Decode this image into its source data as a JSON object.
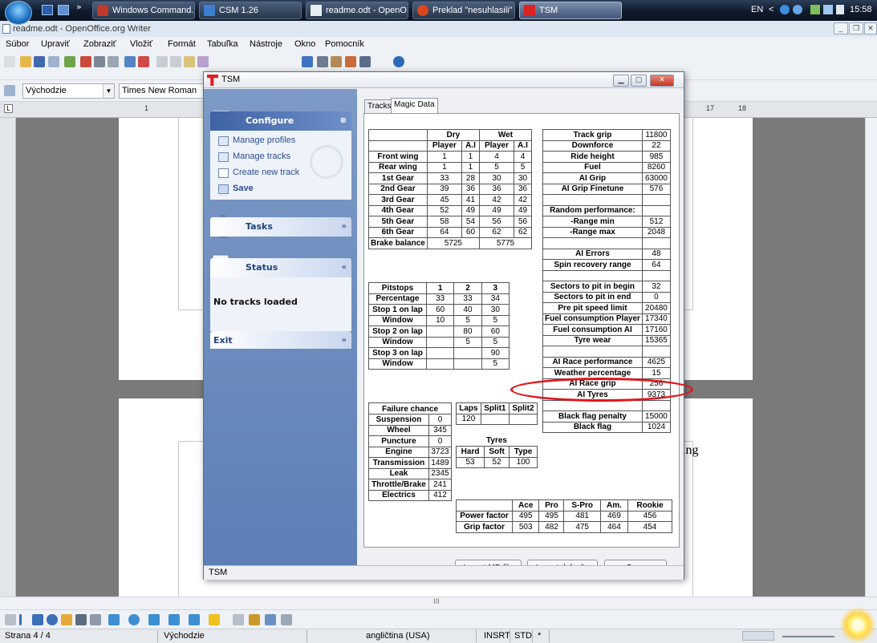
{
  "taskbar": {
    "buttons": [
      {
        "label": "Windows Command..."
      },
      {
        "label": "CSM 1.26"
      },
      {
        "label": "readme.odt - OpenO..."
      },
      {
        "label": "Preklad \"nesuhlasili\" ..."
      },
      {
        "label": "TSM"
      }
    ],
    "chevron": "»",
    "language": "EN",
    "clock": "15:58"
  },
  "writer": {
    "title": "readme.odt - OpenOffice.org Writer",
    "menu": [
      "Súbor",
      "Upraviť",
      "Zobraziť",
      "Vložiť",
      "Formát",
      "Tabuľka",
      "Nástroje",
      "Okno",
      "Pomocník"
    ],
    "style_combo": "Východzie",
    "font_combo": "Times New Roman",
    "ruler_marks": [
      "1",
      "17",
      "18"
    ],
    "page_fragment": "ing",
    "status": {
      "page": "Strana 4 / 4",
      "style": "Východzie",
      "language": "angličtina (USA)",
      "insert": "INSRT",
      "std": "STD",
      "star": "*"
    },
    "hscroll_mark": "III"
  },
  "tsm": {
    "title": "TSM",
    "statusbar": "TSM",
    "sidebar": {
      "configure": {
        "title": "Configure",
        "links": [
          "Manage profiles",
          "Manage tracks",
          "Create new track",
          "Save"
        ]
      },
      "tasks": {
        "title": "Tasks"
      },
      "status": {
        "title": "Status",
        "body": "No tracks loaded"
      },
      "exit": {
        "title": "Exit"
      }
    },
    "tabs": [
      "Tracks",
      "Magic Data"
    ],
    "setup_table": {
      "groups": [
        "Dry",
        "Wet"
      ],
      "cols": [
        "Player",
        "A.I",
        "Player",
        "A.I"
      ],
      "rows": [
        {
          "label": "Front wing",
          "v": [
            "1",
            "1",
            "4",
            "4"
          ]
        },
        {
          "label": "Rear wing",
          "v": [
            "1",
            "1",
            "5",
            "5"
          ]
        },
        {
          "label": "1st Gear",
          "v": [
            "33",
            "28",
            "30",
            "30"
          ]
        },
        {
          "label": "2nd Gear",
          "v": [
            "39",
            "36",
            "36",
            "36"
          ]
        },
        {
          "label": "3rd Gear",
          "v": [
            "45",
            "41",
            "42",
            "42"
          ]
        },
        {
          "label": "4th Gear",
          "v": [
            "52",
            "49",
            "49",
            "49"
          ]
        },
        {
          "label": "5th Gear",
          "v": [
            "58",
            "54",
            "56",
            "56"
          ]
        },
        {
          "label": "6th Gear",
          "v": [
            "64",
            "60",
            "62",
            "62"
          ]
        }
      ],
      "brake_label": "Brake balance",
      "brake_dry": "5725",
      "brake_wet": "5775"
    },
    "pit_table": {
      "header": [
        "Pitstops",
        "1",
        "2",
        "3"
      ],
      "rows": [
        [
          "Percentage",
          "33",
          "33",
          "34"
        ],
        [
          "Stop 1 on lap",
          "60",
          "40",
          "30"
        ],
        [
          "Window",
          "10",
          "5",
          "5"
        ],
        [
          "Stop 2 on lap",
          "",
          "80",
          "60"
        ],
        [
          "Window",
          "",
          "5",
          "5"
        ],
        [
          "Stop 3 on lap",
          "",
          "",
          "90"
        ],
        [
          "Window",
          "",
          "",
          "5"
        ]
      ]
    },
    "right_table": {
      "rows": [
        [
          "Track grip",
          "11800"
        ],
        [
          "Downforce",
          "22"
        ],
        [
          "Ride height",
          "985"
        ],
        [
          "Fuel",
          "8260"
        ],
        [
          "AI Grip",
          "63000"
        ],
        [
          "AI Grip Finetune",
          "576"
        ],
        [
          "",
          ""
        ],
        [
          "Random performance:",
          ""
        ],
        [
          "-Range min",
          "512"
        ],
        [
          "-Range max",
          "2048"
        ],
        [
          "",
          ""
        ],
        [
          "AI Errors",
          "48"
        ],
        [
          "Spin recovery range",
          "64"
        ],
        [
          "",
          ""
        ],
        [
          "Sectors to pit in begin",
          "32"
        ],
        [
          "Sectors to pit in end",
          "0"
        ],
        [
          "Pre pit speed limit",
          "20480"
        ],
        [
          "Fuel consumption Player",
          "17340"
        ],
        [
          "Fuel consumption AI",
          "17160"
        ],
        [
          "Tyre wear",
          "15365"
        ],
        [
          "",
          ""
        ],
        [
          "AI Race performance",
          "4625"
        ],
        [
          "Weather percentage",
          "15"
        ],
        [
          "AI Race grip",
          "256"
        ],
        [
          "AI Tyres",
          "9373"
        ],
        [
          "",
          ""
        ],
        [
          "Black flag penalty",
          "15000"
        ],
        [
          "Black flag",
          "1024"
        ]
      ]
    },
    "failure_table": {
      "header": "Failure chance",
      "rows": [
        [
          "Suspension",
          "0"
        ],
        [
          "Wheel",
          "345"
        ],
        [
          "Puncture",
          "0"
        ],
        [
          "Engine",
          "3723"
        ],
        [
          "Transmission",
          "1489"
        ],
        [
          "Leak",
          "2345"
        ],
        [
          "Throttle/Brake",
          "241"
        ],
        [
          "Electrics",
          "412"
        ]
      ]
    },
    "laps_table": {
      "header": [
        "Laps",
        "Split1",
        "Split2"
      ],
      "values": [
        "120",
        "",
        ""
      ]
    },
    "tyres_table": {
      "title": "Tyres",
      "header": [
        "Hard",
        "Soft",
        "Type"
      ],
      "values": [
        "53",
        "52",
        "100"
      ]
    },
    "factor_table": {
      "header": [
        "",
        "Ace",
        "Pro",
        "S-Pro",
        "Am.",
        "Rookie"
      ],
      "rows": [
        [
          "Power factor",
          "495",
          "495",
          "481",
          "469",
          "456"
        ],
        [
          "Grip factor",
          "503",
          "482",
          "475",
          "464",
          "454"
        ]
      ]
    },
    "buttons": {
      "import_md": "Import MD file",
      "import_defaults": "Import defaults",
      "save": "Save"
    }
  }
}
